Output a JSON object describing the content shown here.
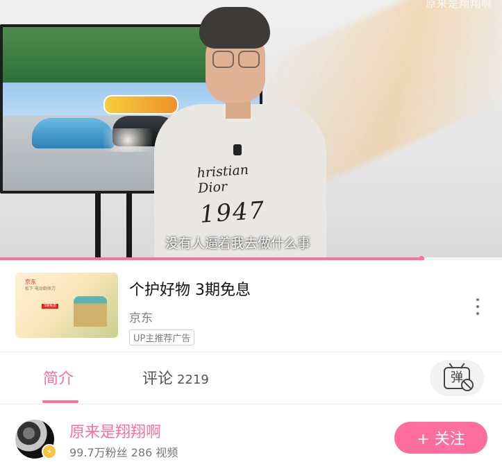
{
  "video": {
    "watermark": "原来是翔翔啊",
    "subtitle": "没有人逼着我去做什么事",
    "progress_fraction": 0.84,
    "shirt_text_line1": "hristian Dior",
    "shirt_text_line2": "1947"
  },
  "ad": {
    "logo_text": "京东",
    "subtitle": "松下 电动剃须刀",
    "badge": "3期免息",
    "title": "个护好物 3期免息",
    "source": "京东",
    "tag": "UP主推荐广告"
  },
  "tabs": [
    {
      "label": "简介"
    },
    {
      "label": "评论",
      "count": "2219"
    }
  ],
  "danmaku": {
    "icon_text": "弹"
  },
  "uploader": {
    "name": "原来是翔翔啊",
    "stats": "99.7万粉丝   286 视频",
    "follow_label": "+ 关注",
    "verified_icon": "⚡"
  }
}
